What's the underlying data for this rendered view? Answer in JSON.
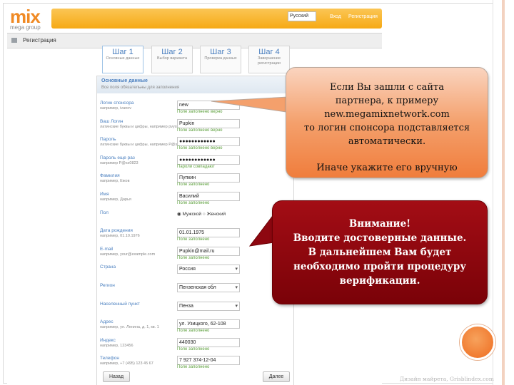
{
  "header": {
    "logo_main_a": "mi",
    "logo_main_b": "x",
    "logo_sub": "mega group",
    "language": "Русский",
    "nav": [
      "Вход",
      "Регистрация"
    ]
  },
  "subbar": {
    "crumb": "Регистрация"
  },
  "steps": [
    {
      "title": "Шаг 1",
      "desc": "Основные данные"
    },
    {
      "title": "Шаг 2",
      "desc": "Выбор варианта"
    },
    {
      "title": "Шаг 3",
      "desc": "Проверка данных"
    },
    {
      "title": "Шаг 4",
      "desc": "Завершение регистрации"
    }
  ],
  "form": {
    "title": "Основные данные",
    "subtitle": "Все поля обязательны для заполнения",
    "rows": [
      {
        "label": "Логин спонсора",
        "hint": "например, ivanov",
        "value": "new",
        "status": "Поле заполнено верно"
      },
      {
        "label": "Ваш Логин",
        "hint": "латинские буквы и цифры, например pvyshkin",
        "value": "Pupkin",
        "status": "Поле заполнено верно"
      },
      {
        "label": "Пароль",
        "hint": "латинские буквы и цифры, например P@ss0823",
        "value": "●●●●●●●●●●●●",
        "status": "Поле заполнено верно"
      },
      {
        "label": "Пароль еще раз",
        "hint": "например P@ss0823",
        "value": "●●●●●●●●●●●●",
        "status": "Пароли совпадают"
      },
      {
        "label": "Фамилия",
        "hint": "например, Ежов",
        "value": "Пупкин",
        "status": "Поле заполнено"
      },
      {
        "label": "Имя",
        "hint": "например, Дарья",
        "value": "Василий",
        "status": "Поле заполнено"
      },
      {
        "label": "Пол",
        "hint": "",
        "value": "",
        "status": "",
        "radio": [
          "Мужской",
          "Женский"
        ]
      },
      {
        "label": "Дата рождения",
        "hint": "например, 01.10.1976",
        "value": "01.01.1975",
        "status": "Поле заполнено"
      },
      {
        "label": "E-mail",
        "hint": "например, your@example.com",
        "value": "Pupkin@mail.ru",
        "status": "Поле заполнено"
      },
      {
        "label": "Страна",
        "hint": "",
        "value": "Россия",
        "status": "",
        "dropdown": true
      },
      {
        "label": "Регион",
        "hint": "",
        "value": "Пензенская обл",
        "status": "",
        "dropdown": true
      },
      {
        "label": "Населенный пункт",
        "hint": "",
        "value": "Пенза",
        "status": "",
        "dropdown": true
      },
      {
        "label": "Адрес",
        "hint": "например, ул. Ленина, д. 1, кв. 1",
        "value": "ул. Узицкого, 62-108",
        "status": "Поле заполнено"
      },
      {
        "label": "Индекс",
        "hint": "например, 123456",
        "value": "440030",
        "status": "Поле заполнено"
      },
      {
        "label": "Телефон",
        "hint": "например, +7 (495) 123 45 67",
        "value": "7 927 374-12-04",
        "status": "Поле заполнено"
      }
    ],
    "back_label": "Назад",
    "next_label": "Далее"
  },
  "callouts": {
    "info_lines": [
      "Если Вы зашли с сайта",
      "партнера, к примеру",
      "new.megamixnetwork.com",
      "то логин спонсора подставляется",
      "автоматически."
    ],
    "info_extra": "Иначе укажите его вручную",
    "warning_lines": [
      "Внимание!",
      "Вводите достоверные данные.",
      "В дальнейшем Вам будет",
      "необходимо пройти процедуру",
      "верификации."
    ]
  },
  "footer": "Дизайн майрета, Grisblindex.com",
  "colors": {
    "orange_bar": "#f6a914",
    "callout_orange": "#f07d3c",
    "callout_red": "#8b0610",
    "step_title": "#4a7fbf"
  }
}
